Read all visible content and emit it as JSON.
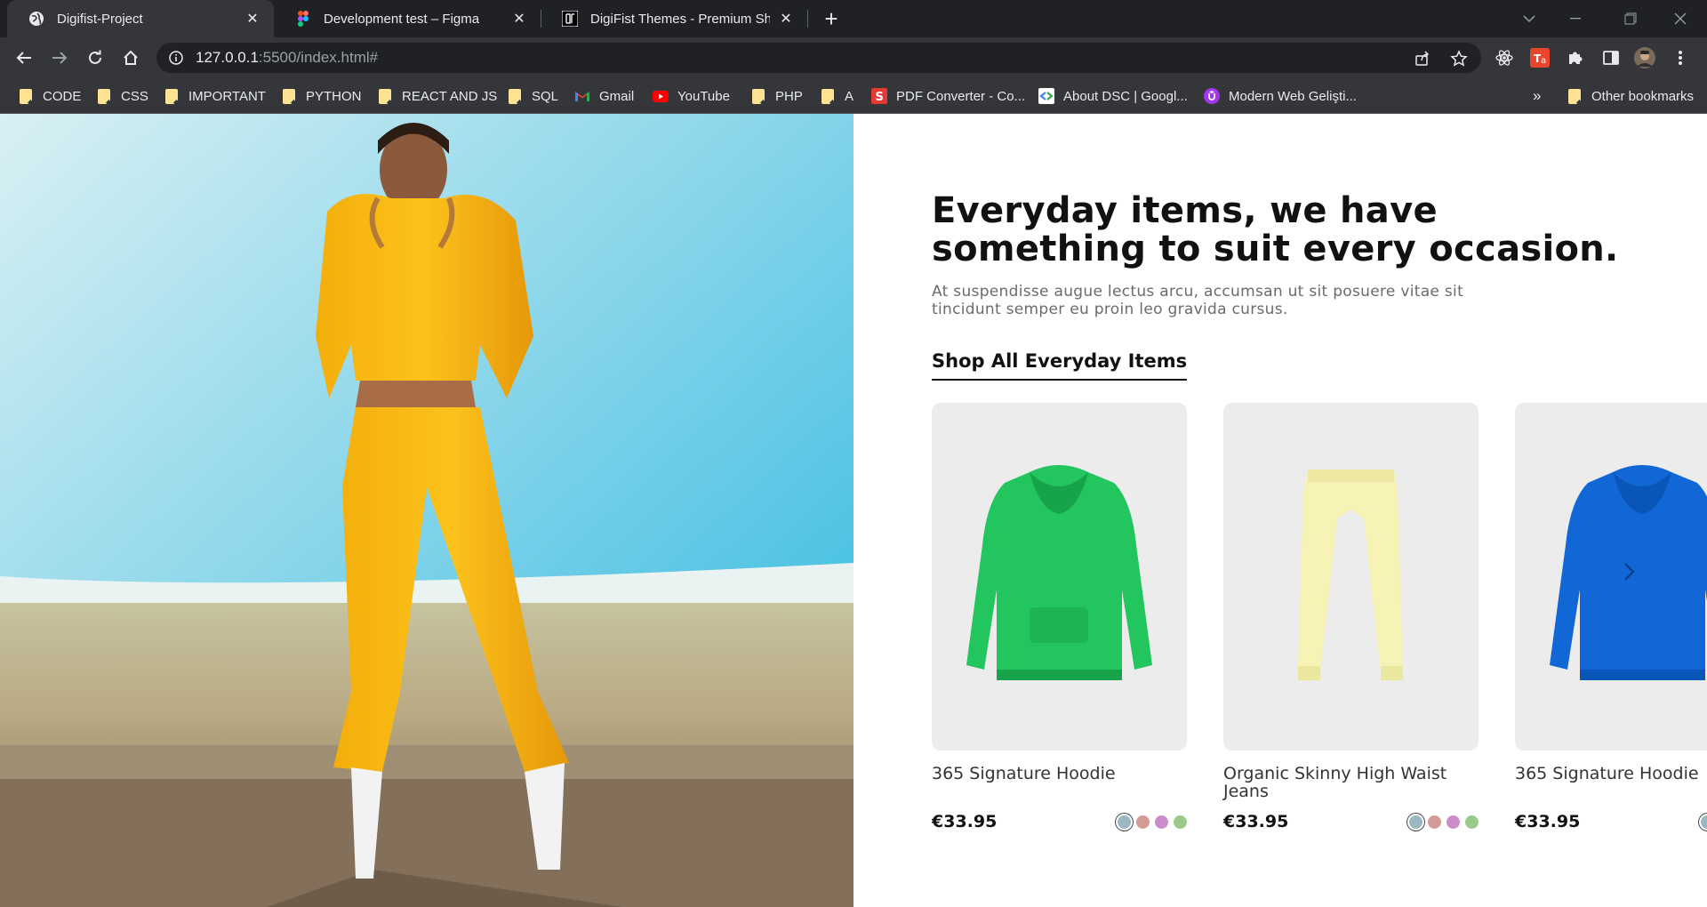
{
  "browser": {
    "tabs": [
      {
        "title": "Digifist-Project",
        "active": true,
        "icon": "globe-icon"
      },
      {
        "title": "Development test – Figma",
        "active": false,
        "icon": "figma-icon"
      },
      {
        "title": "DigiFist Themes - Premium Shop",
        "active": false,
        "icon": "digifist-icon"
      }
    ],
    "url_host": "127.0.0.1",
    "url_rest": ":5500/index.html#",
    "bookmarks": [
      {
        "label": "CODE",
        "icon": "folder-icon"
      },
      {
        "label": "CSS",
        "icon": "folder-icon"
      },
      {
        "label": "IMPORTANT",
        "icon": "folder-icon"
      },
      {
        "label": "PYTHON",
        "icon": "folder-icon"
      },
      {
        "label": "REACT AND JS",
        "icon": "folder-icon"
      },
      {
        "label": "SQL",
        "icon": "folder-icon"
      },
      {
        "label": "Gmail",
        "icon": "gmail-icon"
      },
      {
        "label": "YouTube",
        "icon": "youtube-icon"
      },
      {
        "label": "PHP",
        "icon": "folder-icon"
      },
      {
        "label": "A",
        "icon": "folder-icon"
      },
      {
        "label": "PDF Converter - Co...",
        "icon": "pdf-converter-icon"
      },
      {
        "label": "About DSC | Googl...",
        "icon": "dsc-icon"
      },
      {
        "label": "Modern Web Gelişti...",
        "icon": "udemy-icon"
      }
    ],
    "overflow_label": "»",
    "other_bookmarks": "Other bookmarks"
  },
  "page": {
    "headline_line1": "Everyday items, we have",
    "headline_line2": "something to suit every occasion.",
    "subtitle_line1": "At suspendisse augue lectus arcu, accumsan ut sit posuere vitae sit",
    "subtitle_line2": "tincidunt semper eu proin leo gravida cursus.",
    "shop_link": "Shop All Everyday Items",
    "products": [
      {
        "name_line1": "365 Signature Hoodie",
        "name_line2": "",
        "price": "€33.95",
        "color": "#22c55e",
        "kind": "hoodie"
      },
      {
        "name_line1": "Organic Skinny High Waist",
        "name_line2": "Jeans",
        "price": "€33.95",
        "color": "#f7f3b5",
        "kind": "pants"
      },
      {
        "name_line1": "365 Signature Hoodie",
        "name_line2": "",
        "price": "€33.95",
        "color": "#1167d6",
        "kind": "hoodie"
      }
    ],
    "swatch_colors": [
      "#9ab7c0",
      "#d39b95",
      "#c98cc8",
      "#9bc98b"
    ]
  }
}
